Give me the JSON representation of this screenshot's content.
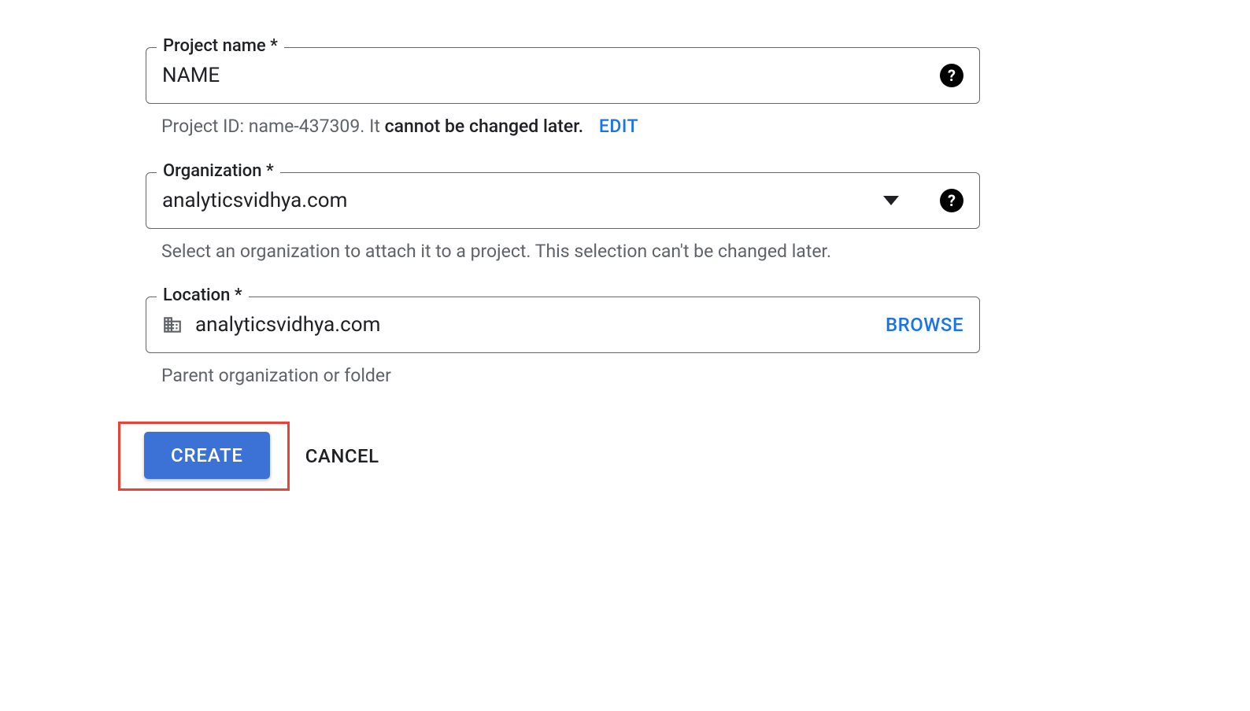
{
  "projectName": {
    "label": "Project name *",
    "value": "NAME"
  },
  "projectIdHelper": {
    "prefix": "Project ID: ",
    "id": "name-437309",
    "suffix": ". It ",
    "bold": "cannot be changed later.",
    "editLabel": "EDIT"
  },
  "organization": {
    "label": "Organization *",
    "value": "analyticsvidhya.com",
    "helper": "Select an organization to attach it to a project. This selection can't be changed later."
  },
  "location": {
    "label": "Location *",
    "value": "analyticsvidhya.com",
    "browseLabel": "BROWSE",
    "helper": "Parent organization or folder"
  },
  "buttons": {
    "create": "CREATE",
    "cancel": "CANCEL"
  }
}
